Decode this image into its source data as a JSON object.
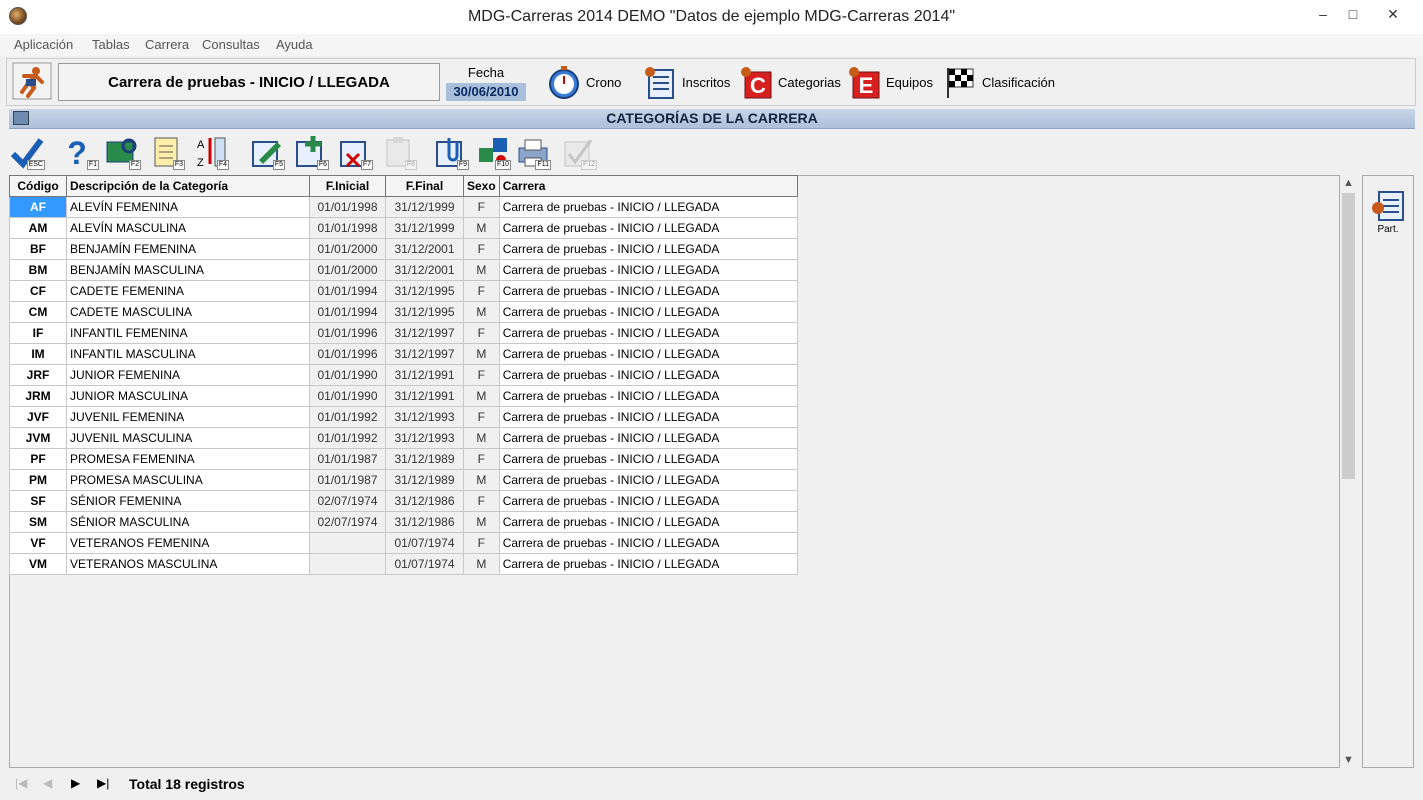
{
  "window": {
    "title": "MDG-Carreras 2014 DEMO \"Datos de ejemplo MDG-Carreras 2014\"",
    "minimize": "–",
    "maximize": "□",
    "close": "✕"
  },
  "menu": [
    "Aplicación",
    "Tablas",
    "Carrera",
    "Consultas",
    "Ayuda"
  ],
  "race": {
    "name": "Carrera de pruebas - INICIO / LLEGADA",
    "date_label": "Fecha",
    "date_value": "30/06/2010"
  },
  "nav": [
    {
      "label": "Crono",
      "icon": "stopwatch-icon"
    },
    {
      "label": "Inscritos",
      "icon": "list-icon"
    },
    {
      "label": "Categorias",
      "icon": "category-c-icon"
    },
    {
      "label": "Equipos",
      "icon": "team-e-icon"
    },
    {
      "label": "Clasificación",
      "icon": "checkered-flag-icon"
    }
  ],
  "panel_title": "CATEGORÍAS DE LA CARRERA",
  "toolbar2_keys": [
    "ESC",
    "F1",
    "F2",
    "F3",
    "F4",
    "F5",
    "F6",
    "F7",
    "F8",
    "F9",
    "F10",
    "F11",
    "F12"
  ],
  "columns": [
    "Código",
    "Descripción de la Categoría",
    "F.Inicial",
    "F.Final",
    "Sexo",
    "Carrera"
  ],
  "rows": [
    [
      "AF",
      "ALEVÍN FEMENINA",
      "01/01/1998",
      "31/12/1999",
      "F",
      "Carrera de pruebas - INICIO / LLEGADA"
    ],
    [
      "AM",
      "ALEVÍN MASCULINA",
      "01/01/1998",
      "31/12/1999",
      "M",
      "Carrera de pruebas - INICIO / LLEGADA"
    ],
    [
      "BF",
      "BENJAMÍN FEMENINA",
      "01/01/2000",
      "31/12/2001",
      "F",
      "Carrera de pruebas - INICIO / LLEGADA"
    ],
    [
      "BM",
      "BENJAMÍN MASCULINA",
      "01/01/2000",
      "31/12/2001",
      "M",
      "Carrera de pruebas - INICIO / LLEGADA"
    ],
    [
      "CF",
      "CADETE FEMENINA",
      "01/01/1994",
      "31/12/1995",
      "F",
      "Carrera de pruebas - INICIO / LLEGADA"
    ],
    [
      "CM",
      "CADETE MASCULINA",
      "01/01/1994",
      "31/12/1995",
      "M",
      "Carrera de pruebas - INICIO / LLEGADA"
    ],
    [
      "IF",
      "INFANTIL FEMENINA",
      "01/01/1996",
      "31/12/1997",
      "F",
      "Carrera de pruebas - INICIO / LLEGADA"
    ],
    [
      "IM",
      "INFANTIL MASCULINA",
      "01/01/1996",
      "31/12/1997",
      "M",
      "Carrera de pruebas - INICIO / LLEGADA"
    ],
    [
      "JRF",
      "JUNIOR FEMENINA",
      "01/01/1990",
      "31/12/1991",
      "F",
      "Carrera de pruebas - INICIO / LLEGADA"
    ],
    [
      "JRM",
      "JUNIOR MASCULINA",
      "01/01/1990",
      "31/12/1991",
      "M",
      "Carrera de pruebas - INICIO / LLEGADA"
    ],
    [
      "JVF",
      "JUVENIL FEMENINA",
      "01/01/1992",
      "31/12/1993",
      "F",
      "Carrera de pruebas - INICIO / LLEGADA"
    ],
    [
      "JVM",
      "JUVENIL MASCULINA",
      "01/01/1992",
      "31/12/1993",
      "M",
      "Carrera de pruebas - INICIO / LLEGADA"
    ],
    [
      "PF",
      "PROMESA FEMENINA",
      "01/01/1987",
      "31/12/1989",
      "F",
      "Carrera de pruebas - INICIO / LLEGADA"
    ],
    [
      "PM",
      "PROMESA MASCULINA",
      "01/01/1987",
      "31/12/1989",
      "M",
      "Carrera de pruebas - INICIO / LLEGADA"
    ],
    [
      "SF",
      "SÉNIOR FEMENINA",
      "02/07/1974",
      "31/12/1986",
      "F",
      "Carrera de pruebas - INICIO / LLEGADA"
    ],
    [
      "SM",
      "SÉNIOR MASCULINA",
      "02/07/1974",
      "31/12/1986",
      "M",
      "Carrera de pruebas - INICIO / LLEGADA"
    ],
    [
      "VF",
      "VETERANOS FEMENINA",
      "",
      "01/07/1974",
      "F",
      "Carrera de pruebas - INICIO / LLEGADA"
    ],
    [
      "VM",
      "VETERANOS MASCULINA",
      "",
      "01/07/1974",
      "M",
      "Carrera de pruebas - INICIO / LLEGADA"
    ]
  ],
  "selected_row": 0,
  "side": {
    "part_label": "Part."
  },
  "status": {
    "first": "|◀",
    "prev": "◀",
    "next": "▶",
    "last": "▶|",
    "total": "Total 18 registros"
  },
  "colors": {
    "selection": "#3399ff",
    "band": "#aebfd8",
    "date_bg": "#a9c0dc"
  }
}
